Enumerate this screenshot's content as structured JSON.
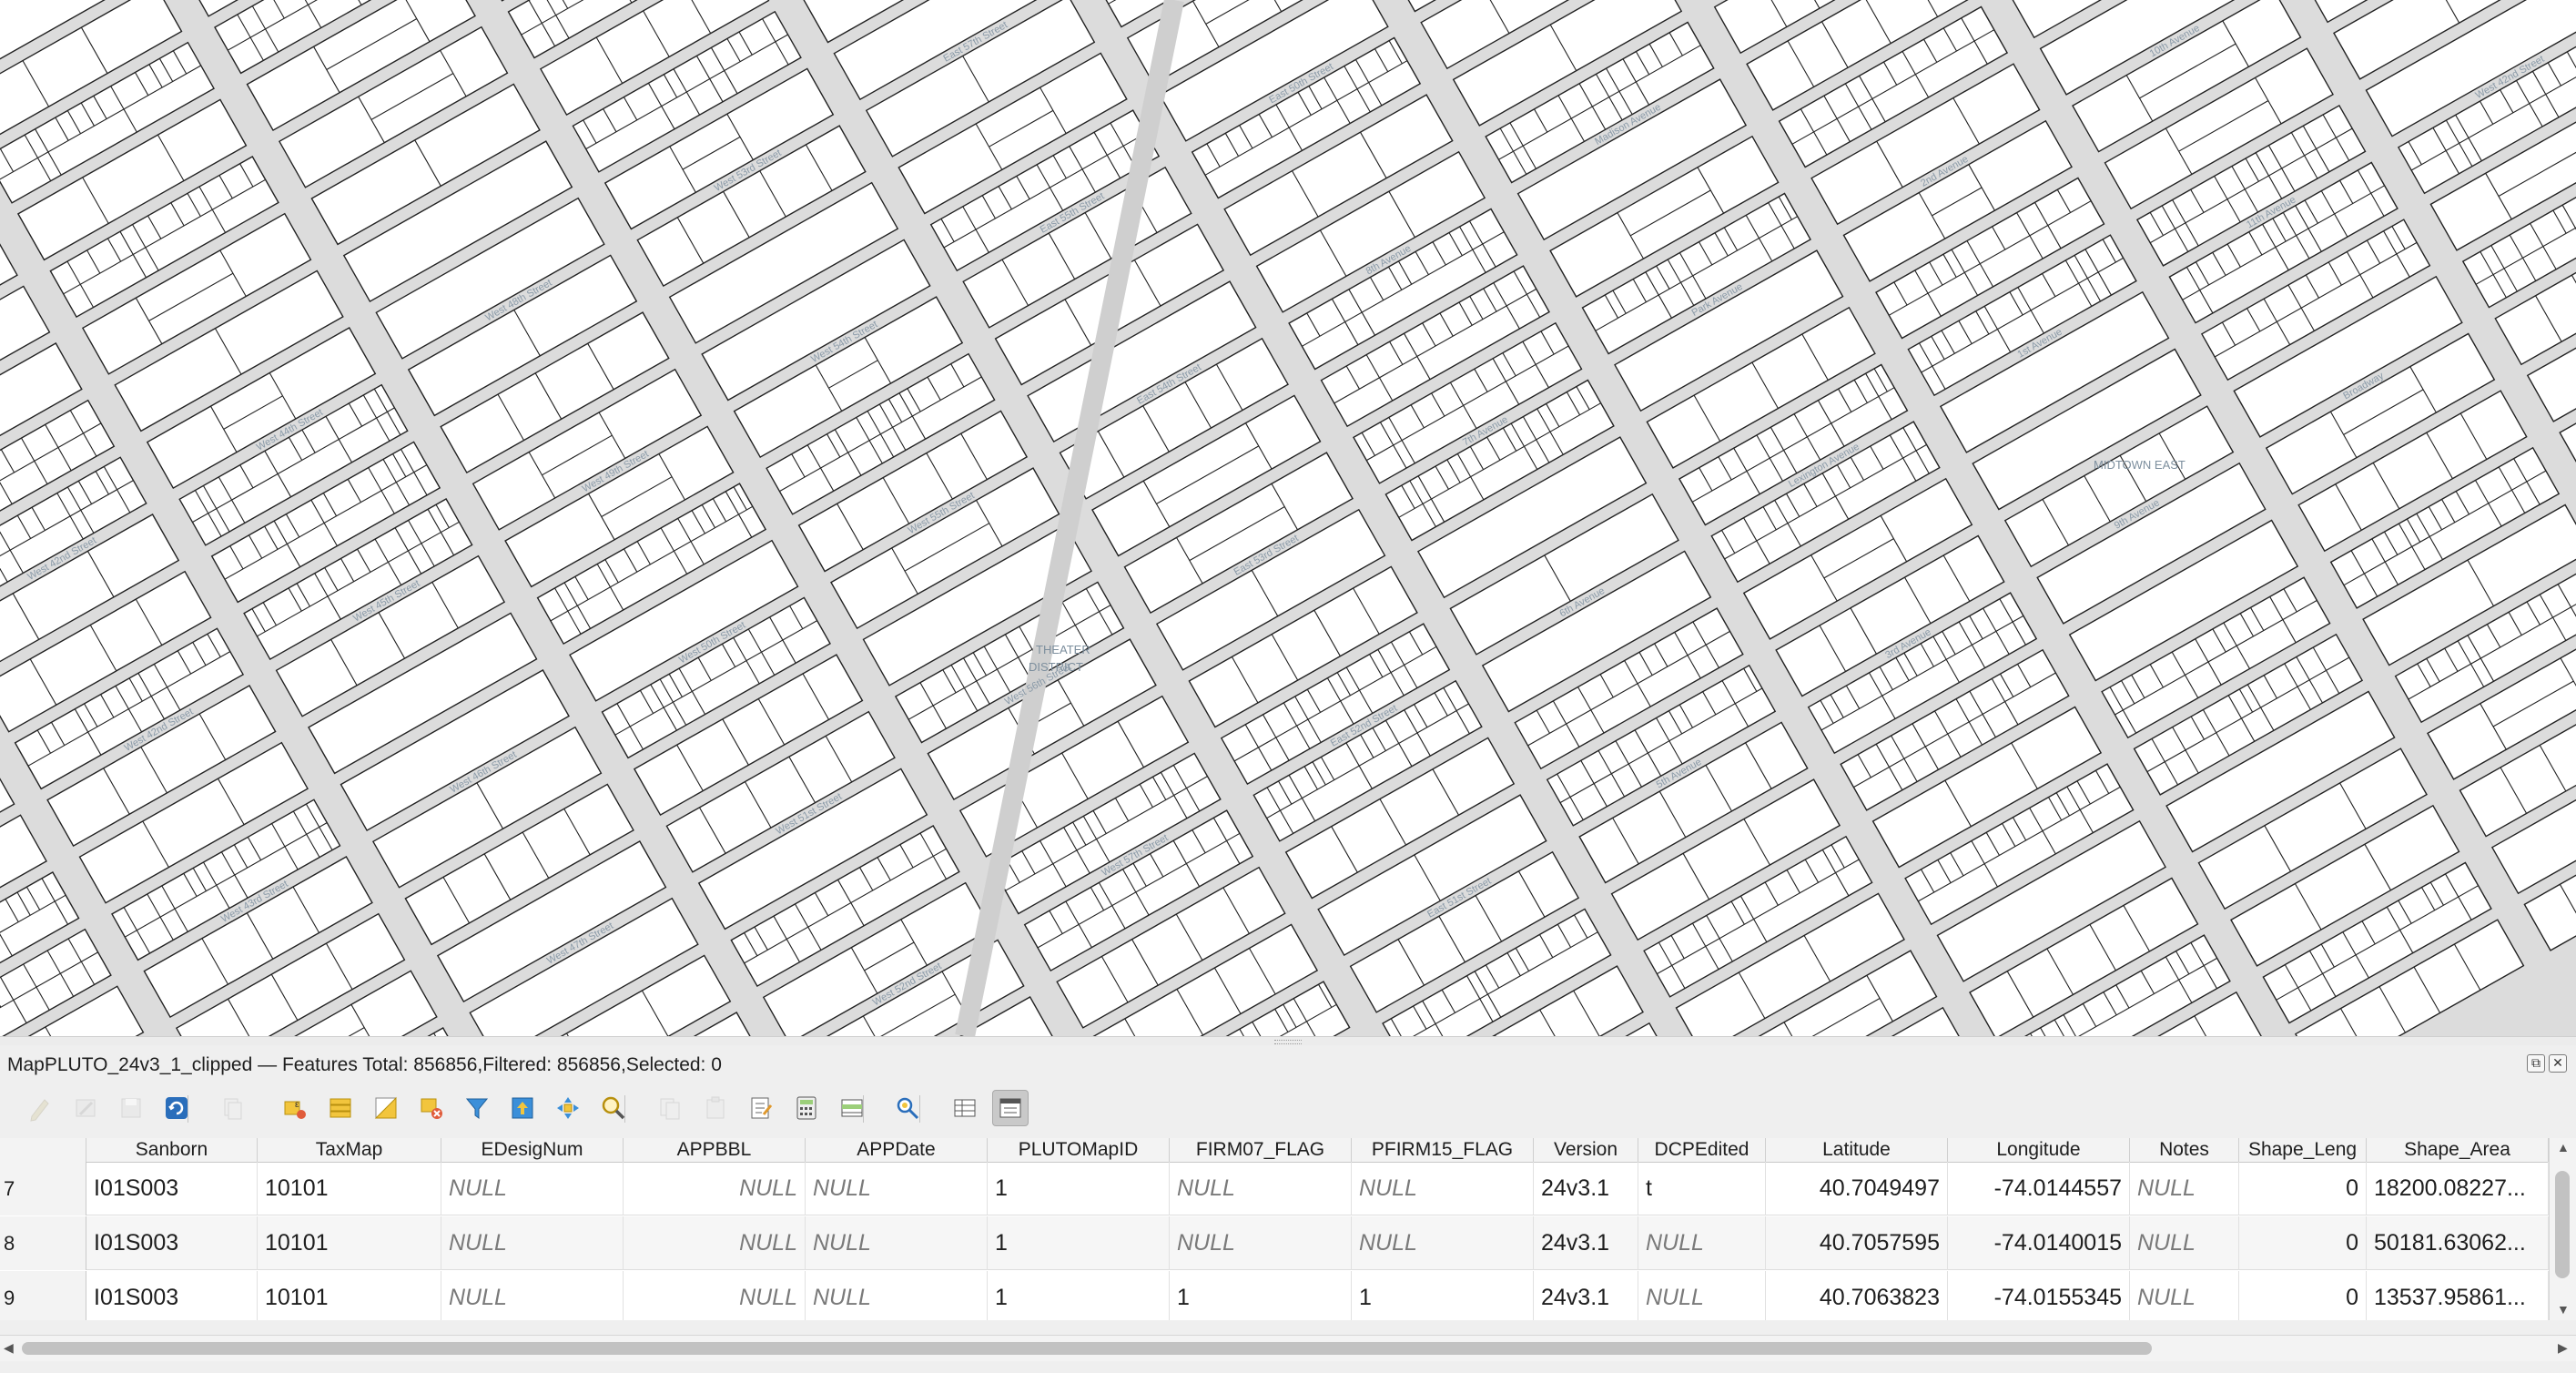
{
  "map": {
    "background": "#dcdcdc",
    "street_labels": [
      "West 42nd Street",
      "West 42nd Street",
      "West 43rd Street",
      "West 44th Street",
      "West 45th Street",
      "West 46th Street",
      "West 47th Street",
      "West 48th Street",
      "West 49th Street",
      "West 50th Street",
      "West 51st Street",
      "West 52nd Street",
      "West 53rd Street",
      "West 54th Street",
      "West 55th Street",
      "West 56th Street",
      "West 57th Street",
      "East 57th Street",
      "East 55th Street",
      "East 54th Street",
      "East 53rd Street",
      "East 52nd Street",
      "East 51st Street",
      "East 50th Street",
      "8th Avenue",
      "7th Avenue",
      "6th Avenue",
      "5th Avenue",
      "Madison Avenue",
      "Park Avenue",
      "Lexington Avenue",
      "3rd Avenue",
      "2nd Avenue",
      "1st Avenue",
      "9th Avenue",
      "10th Avenue",
      "11th Avenue",
      "Broadway"
    ],
    "area_labels": [
      "THEATER",
      "DISTRICT",
      "MIDTOWN EAST"
    ]
  },
  "attribute_table": {
    "title": "MapPLUTO_24v3_1_clipped — Features Total: 856856,Filtered: 856856,Selected: 0",
    "window_buttons": [
      "⧉",
      "✕"
    ],
    "toolbar": [
      {
        "icon": "pencil-edit-icon",
        "enabled": false
      },
      {
        "icon": "multi-edit-icon",
        "enabled": false
      },
      {
        "icon": "save-edits-icon",
        "enabled": false
      },
      {
        "icon": "reload-icon",
        "enabled": true
      },
      {
        "icon": "add-feature-icon",
        "enabled": false
      },
      {
        "icon": "select-by-expression-icon",
        "enabled": true
      },
      {
        "icon": "select-all-icon",
        "enabled": true
      },
      {
        "icon": "invert-selection-icon",
        "enabled": true
      },
      {
        "icon": "deselect-all-icon",
        "enabled": true
      },
      {
        "icon": "filter-icon",
        "enabled": true
      },
      {
        "icon": "move-selection-top-icon",
        "enabled": true
      },
      {
        "icon": "pan-to-selection-icon",
        "enabled": true
      },
      {
        "icon": "zoom-to-selection-icon",
        "enabled": true
      },
      {
        "icon": "copy-rows-icon",
        "enabled": false
      },
      {
        "icon": "paste-features-icon",
        "enabled": false
      },
      {
        "icon": "new-field-icon",
        "enabled": true
      },
      {
        "icon": "field-calculator-icon",
        "enabled": true
      },
      {
        "icon": "conditional-formatting-icon",
        "enabled": true
      },
      {
        "icon": "actions-icon",
        "enabled": true
      },
      {
        "icon": "dock-table-icon",
        "enabled": true
      },
      {
        "icon": "form-view-icon",
        "enabled": true
      }
    ],
    "columns": [
      "Sanborn",
      "TaxMap",
      "EDesigNum",
      "APPBBL",
      "APPDate",
      "PLUTOMapID",
      "FIRM07_FLAG",
      "PFIRM15_FLAG",
      "Version",
      "DCPEdited",
      "Latitude",
      "Longitude",
      "Notes",
      "Shape_Leng",
      "Shape_Area"
    ],
    "rows": [
      {
        "num": "7",
        "cells": [
          "I01S003",
          "10101",
          "NULL",
          "NULL",
          "NULL",
          "1",
          "NULL",
          "NULL",
          "24v3.1",
          "t",
          "40.7049497",
          "-74.0144557",
          "NULL",
          "0",
          "18200.08227..."
        ]
      },
      {
        "num": "8",
        "cells": [
          "I01S003",
          "10101",
          "NULL",
          "NULL",
          "NULL",
          "1",
          "NULL",
          "NULL",
          "24v3.1",
          "NULL",
          "40.7057595",
          "-74.0140015",
          "NULL",
          "0",
          "50181.63062..."
        ]
      },
      {
        "num": "9",
        "cells": [
          "I01S003",
          "10101",
          "NULL",
          "NULL",
          "NULL",
          "1",
          "1",
          "1",
          "24v3.1",
          "NULL",
          "40.7063823",
          "-74.0155345",
          "NULL",
          "0",
          "13537.95861..."
        ]
      }
    ]
  }
}
